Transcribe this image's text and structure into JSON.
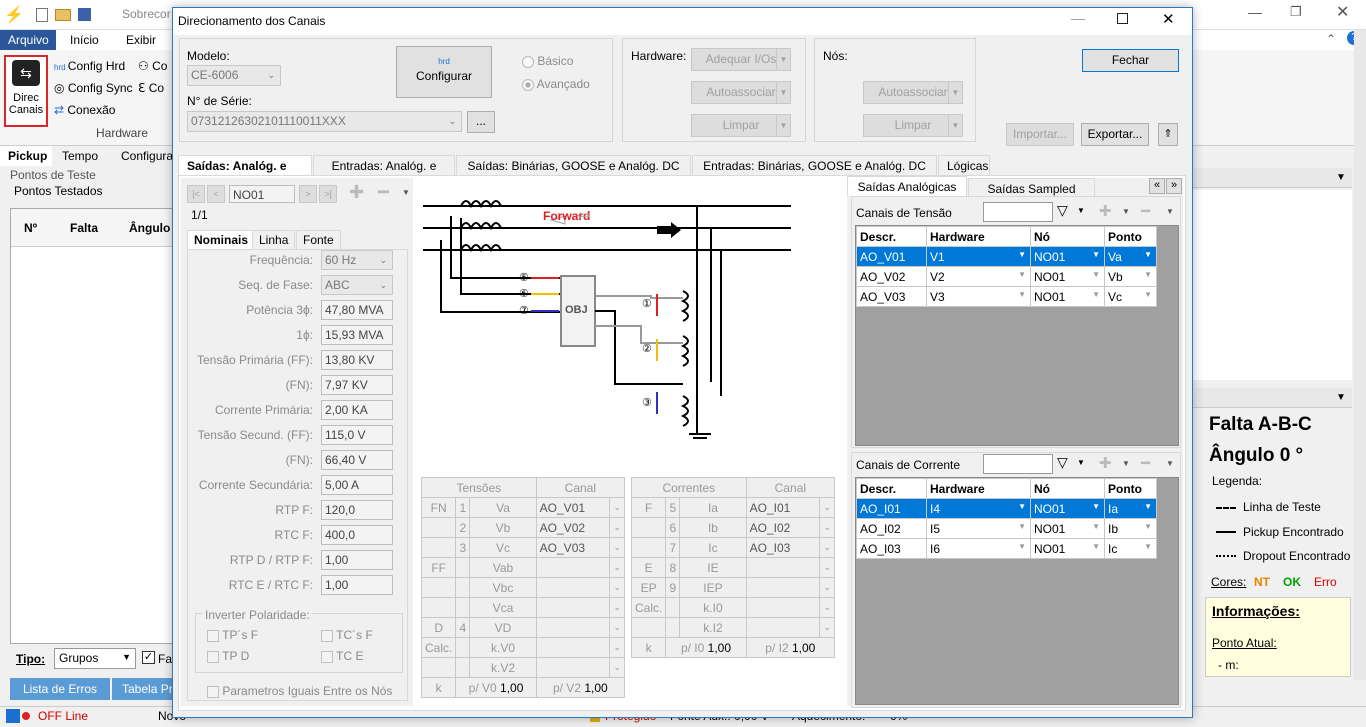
{
  "app": {
    "title_partial": "Sobrecor",
    "tabs": [
      "Arquivo",
      "Início",
      "Exibir"
    ],
    "ribbon": {
      "direc_label": "Direc\nCanais",
      "config_hrd": "Config Hrd",
      "config_sync": "Config Sync",
      "conexao": "Conexão",
      "group_hardware": "Hardware",
      "co1": "Co",
      "co2": "Co"
    },
    "left": {
      "tabs": [
        "Pickup",
        "Tempo",
        "Configuraç"
      ],
      "pontos_de_teste": "Pontos de Teste",
      "pontos_testados": "Pontos Testados",
      "cols": [
        "Nº",
        "Falta",
        "Ângulo"
      ],
      "tipo_label": "Tipo:",
      "tipo_value": "Grupos",
      "fal": "Fal",
      "lista_de_erros": "Lista de Erros",
      "tabela_pro": "Tabela Pro"
    },
    "status": {
      "offline": "OFF Line",
      "novo": "Novo",
      "protegido": "Protegido",
      "fonte_aux": "Fonte Aux.: 0,00 V",
      "aquecimento": "Aquecimento:",
      "pct": "0%"
    },
    "right": {
      "falta": "Falta A-B-C",
      "angulo": "Ângulo 0 °",
      "legenda": "Legenda:",
      "linha": "Linha de Teste",
      "pickup": "Pickup Encontrado",
      "dropout": "Dropout Encontrado",
      "cores": "Cores:",
      "nt": "NT",
      "ok": "OK",
      "erro": "Erro",
      "informacoes": "Informações:",
      "ponto_atual": "Ponto Atual:",
      "m": "- m:"
    }
  },
  "dialog": {
    "title": "Direcionamento dos Canais",
    "modelo_label": "Modelo:",
    "modelo_value": "CE-6006",
    "serie_label": "N° de Série:",
    "serie_value": "07312126302101110011XXX",
    "dots": "...",
    "configurar": "Configurar",
    "basico": "Básico",
    "avancado": "Avançado",
    "hardware_label": "Hardware:",
    "adequar": "Adequar I/Os",
    "autoassociar": "Autoassociar",
    "limpar": "Limpar",
    "nos_label": "Nós:",
    "fechar": "Fechar",
    "importar": "Importar...",
    "exportar": "Exportar...",
    "tabs": [
      "Saídas: Analóg. e SV",
      "Entradas: Analóg. e SV",
      "Saídas: Binárias, GOOSE e Analóg. DC",
      "Entradas: Binárias, GOOSE e Analóg. DC",
      "Lógicas"
    ],
    "nav_value": "NO01",
    "page": "1/1",
    "subtabs": [
      "Nominais",
      "Linha",
      "Fonte"
    ],
    "params": [
      {
        "label": "Frequência:",
        "value": "60 Hz",
        "combo": true
      },
      {
        "label": "Seq. de Fase:",
        "value": "ABC",
        "combo": true
      },
      {
        "label": "Potência 3ϕ:",
        "value": "47,80 MVA"
      },
      {
        "label": "1ϕ:",
        "value": "15,93 MVA"
      },
      {
        "label": "Tensão Primária (FF):",
        "value": "13,80 KV"
      },
      {
        "label": "(FN):",
        "value": "7,97 KV"
      },
      {
        "label": "Corrente Primária:",
        "value": "2,00 KA"
      },
      {
        "label": "Tensão Secund. (FF):",
        "value": "115,0 V"
      },
      {
        "label": "(FN):",
        "value": "66,40 V"
      },
      {
        "label": "Corrente Secundária:",
        "value": "5,00 A"
      },
      {
        "label": "RTP F:",
        "value": "120,0"
      },
      {
        "label": "RTC F:",
        "value": "400,0"
      },
      {
        "label": "RTP D / RTP F:",
        "value": "1,00"
      },
      {
        "label": "RTC E / RTC F:",
        "value": "1,00"
      }
    ],
    "inverter": "Inverter Polaridade:",
    "tps_f": "TP´s F",
    "tcs_f": "TC´s F",
    "tp_d": "TP D",
    "tc_e": "TC E",
    "parametros_iguais": "Parametros Iguais Entre os Nós",
    "forward": "Forward",
    "obj": "OBJ",
    "tensoes": "Tensões",
    "correntes": "Correntes",
    "canal": "Canal",
    "v_rows": [
      {
        "g": "FN",
        "n": "1",
        "s": "Va",
        "c": "AO_V01"
      },
      {
        "g": "",
        "n": "2",
        "s": "Vb",
        "c": "AO_V02"
      },
      {
        "g": "",
        "n": "3",
        "s": "Vc",
        "c": "AO_V03"
      },
      {
        "g": "FF",
        "n": "",
        "s": "Vab",
        "c": ""
      },
      {
        "g": "",
        "n": "",
        "s": "Vbc",
        "c": ""
      },
      {
        "g": "",
        "n": "",
        "s": "Vca",
        "c": ""
      },
      {
        "g": "D",
        "n": "4",
        "s": "VD",
        "c": ""
      },
      {
        "g": "Calc.",
        "n": "",
        "s": "k.V0",
        "c": ""
      },
      {
        "g": "",
        "n": "",
        "s": "k.V2",
        "c": ""
      }
    ],
    "i_rows": [
      {
        "g": "F",
        "n": "5",
        "s": "Ia",
        "c": "AO_I01"
      },
      {
        "g": "",
        "n": "6",
        "s": "Ib",
        "c": "AO_I02"
      },
      {
        "g": "",
        "n": "7",
        "s": "Ic",
        "c": "AO_I03"
      },
      {
        "g": "E",
        "n": "8",
        "s": "IE",
        "c": ""
      },
      {
        "g": "EP",
        "n": "9",
        "s": "IEP",
        "c": ""
      },
      {
        "g": "Calc.",
        "n": "",
        "s": "k.I0",
        "c": ""
      },
      {
        "g": "",
        "n": "",
        "s": "k.I2",
        "c": ""
      }
    ],
    "k_v": {
      "k": "k",
      "p0": "p/ V0",
      "v0": "1,00",
      "p2": "p/ V2",
      "v2": "1,00"
    },
    "k_i": {
      "k": "k",
      "p0": "p/ I0",
      "v0": "1,00",
      "p2": "p/ I2",
      "v2": "1,00"
    },
    "rtabs": [
      "Saídas Analógicas",
      "Saídas Sampled Value"
    ],
    "tensao_label": "Canais de Tensão",
    "corrente_label": "Canais de Corrente",
    "grid_cols": [
      "Descr.",
      "Hardware",
      "Nó",
      "Ponto"
    ],
    "v_grid": [
      {
        "d": "AO_V01",
        "h": "V1",
        "n": "NO01",
        "p": "Va"
      },
      {
        "d": "AO_V02",
        "h": "V2",
        "n": "NO01",
        "p": "Vb"
      },
      {
        "d": "AO_V03",
        "h": "V3",
        "n": "NO01",
        "p": "Vc"
      }
    ],
    "i_grid": [
      {
        "d": "AO_I01",
        "h": "I4",
        "n": "NO01",
        "p": "Ia"
      },
      {
        "d": "AO_I02",
        "h": "I5",
        "n": "NO01",
        "p": "Ib"
      },
      {
        "d": "AO_I03",
        "h": "I6",
        "n": "NO01",
        "p": "Ic"
      }
    ],
    "nums": [
      "⑤",
      "⑥",
      "⑦",
      "①",
      "②",
      "③"
    ]
  }
}
